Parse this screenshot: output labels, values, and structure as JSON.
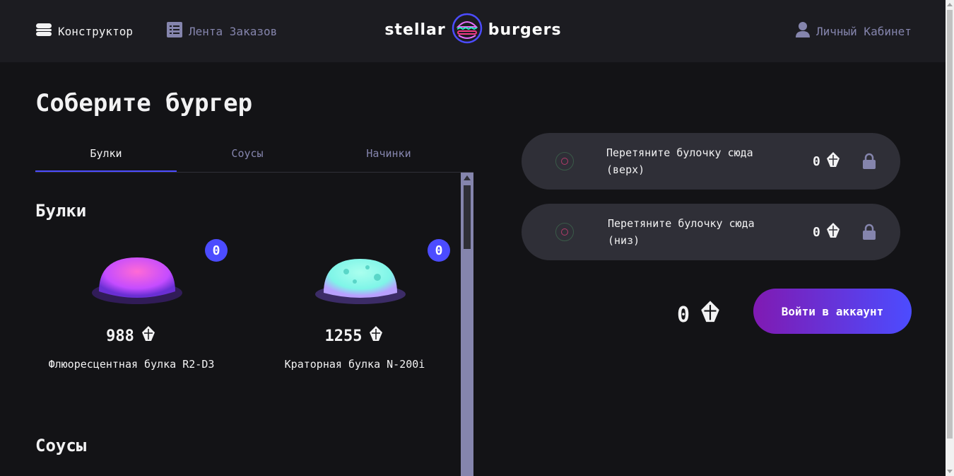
{
  "header": {
    "nav": {
      "constructor_label": "Конструктор",
      "feed_label": "Лента Заказов",
      "profile_label": "Личный Кабинет"
    },
    "logo": {
      "left_text": "stellar",
      "right_text": "burgers"
    }
  },
  "main": {
    "title": "Соберите бургер",
    "tabs": [
      {
        "label": "Булки",
        "active": true
      },
      {
        "label": "Соусы",
        "active": false
      },
      {
        "label": "Начинки",
        "active": false
      }
    ],
    "sections": {
      "buns_title": "Булки",
      "sauces_title": "Соусы"
    },
    "buns": [
      {
        "name": "Флюоресцентная булка R2-D3",
        "price": "988",
        "count": "0",
        "color": "#c44cff"
      },
      {
        "name": "Краторная булка N-200i",
        "price": "1255",
        "count": "0",
        "color": "#7ff5e8"
      }
    ]
  },
  "constructor": {
    "top_slot": {
      "text_line1": "Перетяните булочку сюда",
      "text_line2": "(верх)",
      "price": "0"
    },
    "bottom_slot": {
      "text_line1": "Перетяните булочку сюда",
      "text_line2": "(низ)",
      "price": "0"
    },
    "total": "0",
    "login_button": "Войти в аккаунт"
  },
  "colors": {
    "accent": "#4c4cff",
    "background": "#131316",
    "header": "#1c1c21",
    "inactive_text": "#8585ad"
  }
}
